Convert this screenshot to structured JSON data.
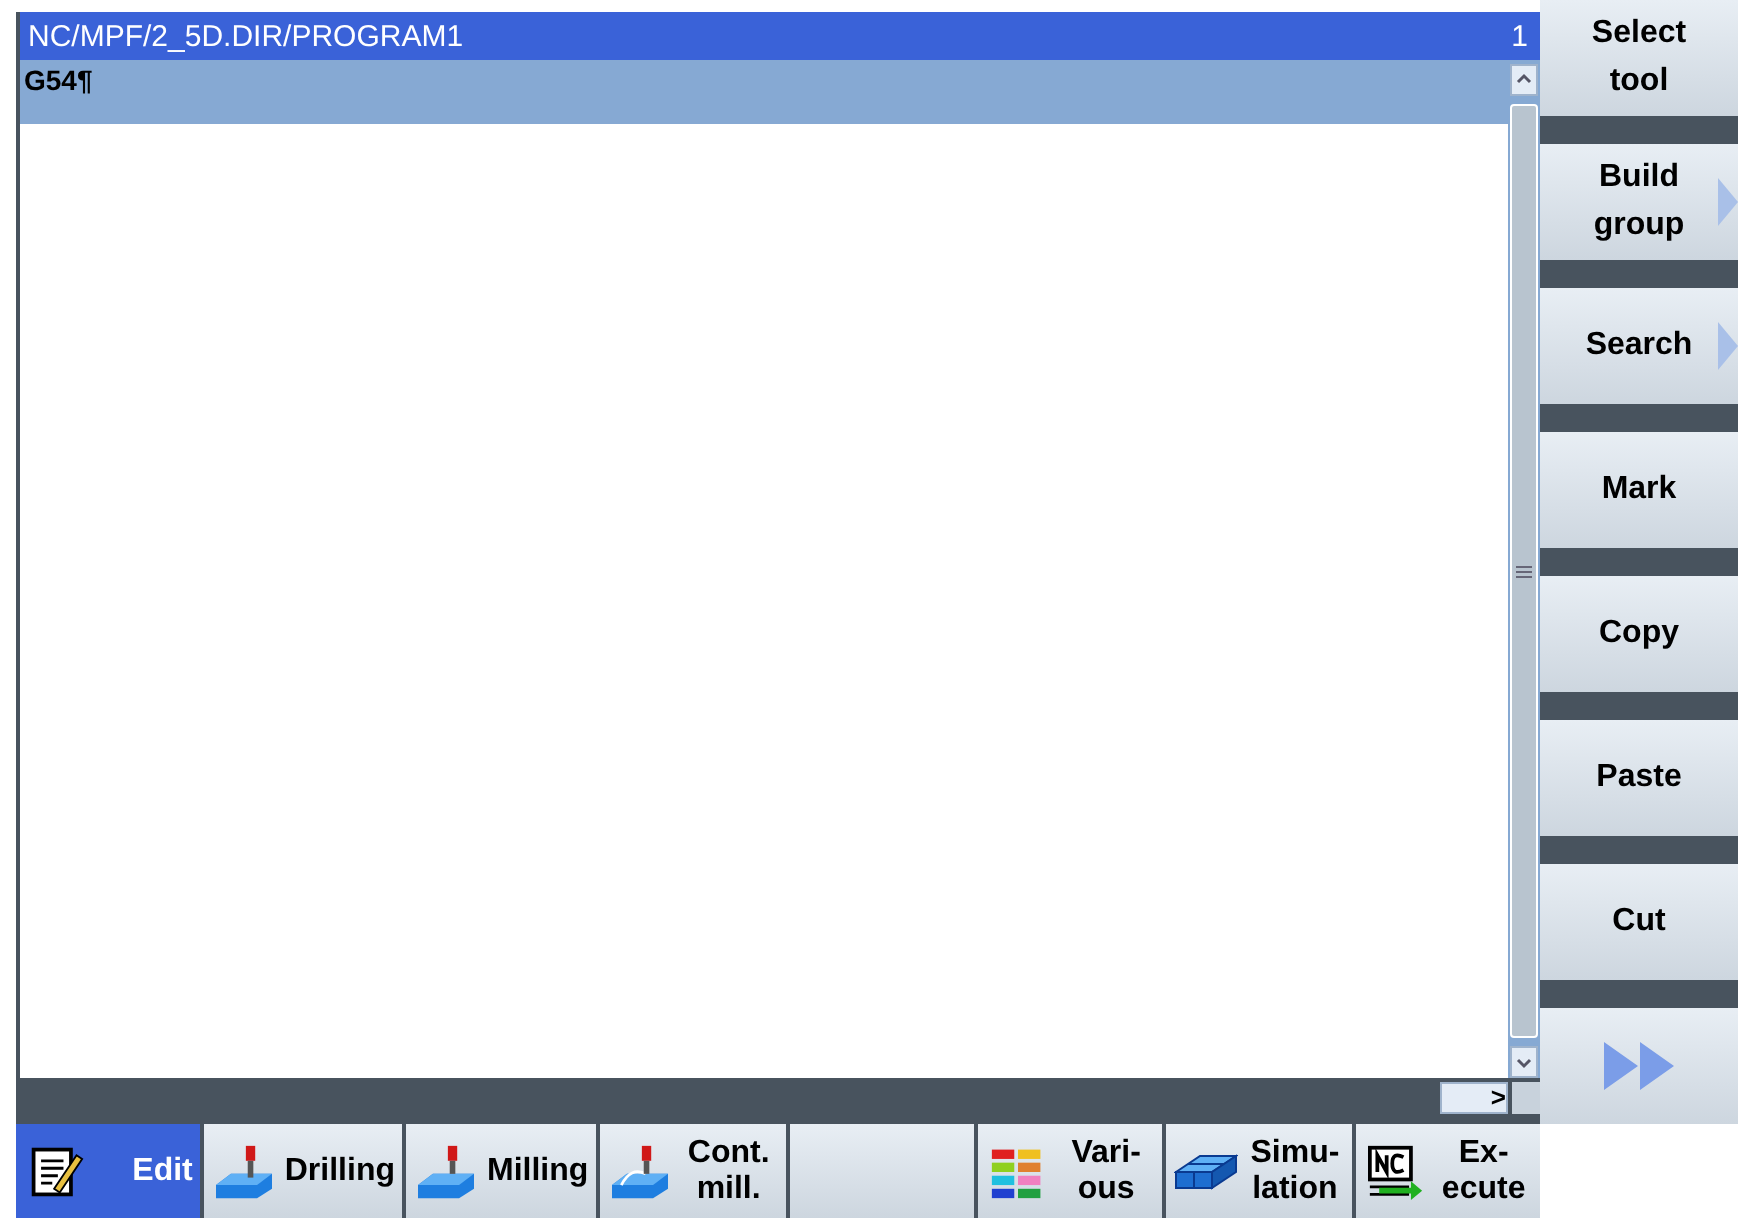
{
  "editor": {
    "path": "NC/MPF/2_5D.DIR/PROGRAM1",
    "line_count": "1",
    "lines": [
      {
        "text": "G54¶",
        "selected": true
      }
    ],
    "hscroll_button": ">"
  },
  "vertical_softkeys": [
    {
      "label": "Select tool",
      "more": false
    },
    {
      "label": "Build group",
      "more": true
    },
    {
      "label": "Search",
      "more": true
    },
    {
      "label": "Mark",
      "more": false
    },
    {
      "label": "Copy",
      "more": false
    },
    {
      "label": "Paste",
      "more": false
    },
    {
      "label": "Cut",
      "more": false
    },
    {
      "kind": "next",
      "more": false
    }
  ],
  "horizontal_softkeys": [
    {
      "label": "Edit",
      "kind": "edit",
      "selected": true
    },
    {
      "label": "Drilling",
      "kind": "drill",
      "selected": false
    },
    {
      "label": "Milling",
      "kind": "mill",
      "selected": false
    },
    {
      "label": "Cont. mill.",
      "kind": "contour",
      "selected": false
    },
    {
      "kind": "blank",
      "selected": false
    },
    {
      "label": "Vari- ous",
      "kind": "various",
      "selected": false
    },
    {
      "label": "Simu- lation",
      "kind": "sim",
      "selected": false
    },
    {
      "label": "Ex- ecute",
      "kind": "nc",
      "selected": false
    }
  ]
}
